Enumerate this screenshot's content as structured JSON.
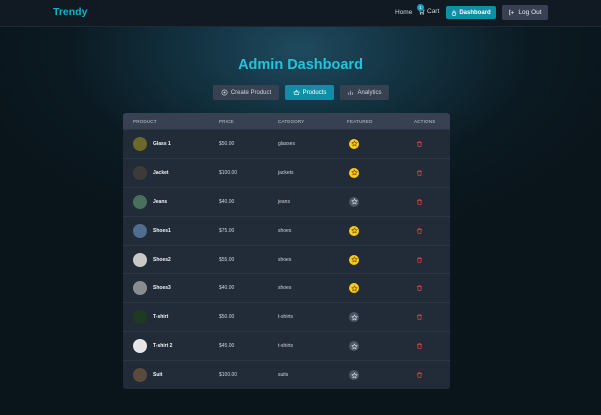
{
  "navbar": {
    "brand": "Trendy",
    "home": "Home",
    "cart": "Cart",
    "cart_count": "1",
    "dashboard": "Dashboard",
    "logout": "Log Out"
  },
  "page": {
    "title": "Admin Dashboard"
  },
  "tabs": [
    {
      "label": "Create Product",
      "icon": "plus-circle-icon",
      "active": false
    },
    {
      "label": "Products",
      "icon": "basket-icon",
      "active": true
    },
    {
      "label": "Analytics",
      "icon": "bar-chart-icon",
      "active": false
    }
  ],
  "table": {
    "headers": [
      "PRODUCT",
      "PRICE",
      "CATEGORY",
      "FEATURED",
      "ACTIONS"
    ],
    "rows": [
      {
        "name": "Glass 1",
        "price": "$50.00",
        "category": "glasses",
        "featured": true,
        "thumb": "#6b6a2a"
      },
      {
        "name": "Jacket",
        "price": "$100.00",
        "category": "jackets",
        "featured": true,
        "thumb": "#3b3b3b"
      },
      {
        "name": "Jeans",
        "price": "$40.00",
        "category": "jeans",
        "featured": false,
        "thumb": "#4a6f5c"
      },
      {
        "name": "Shoes1",
        "price": "$75.00",
        "category": "shoes",
        "featured": true,
        "thumb": "#4f6d8f"
      },
      {
        "name": "Shoes2",
        "price": "$55.00",
        "category": "shoes",
        "featured": true,
        "thumb": "#c8c8c8"
      },
      {
        "name": "Shoes3",
        "price": "$40.00",
        "category": "shoes",
        "featured": true,
        "thumb": "#8a8d8f"
      },
      {
        "name": "T-shirt",
        "price": "$50.00",
        "category": "t-shirts",
        "featured": false,
        "thumb": "#1f3a22"
      },
      {
        "name": "T-shirt 2",
        "price": "$45.00",
        "category": "t-shirts",
        "featured": false,
        "thumb": "#e6e6ea"
      },
      {
        "name": "Suit",
        "price": "$100.00",
        "category": "suits",
        "featured": false,
        "thumb": "#5b4a3c"
      }
    ]
  },
  "colors": {
    "accent": "#0e8fa8",
    "title": "#22c4dc",
    "star_on": "#facc15",
    "trash": "#ef4444"
  }
}
